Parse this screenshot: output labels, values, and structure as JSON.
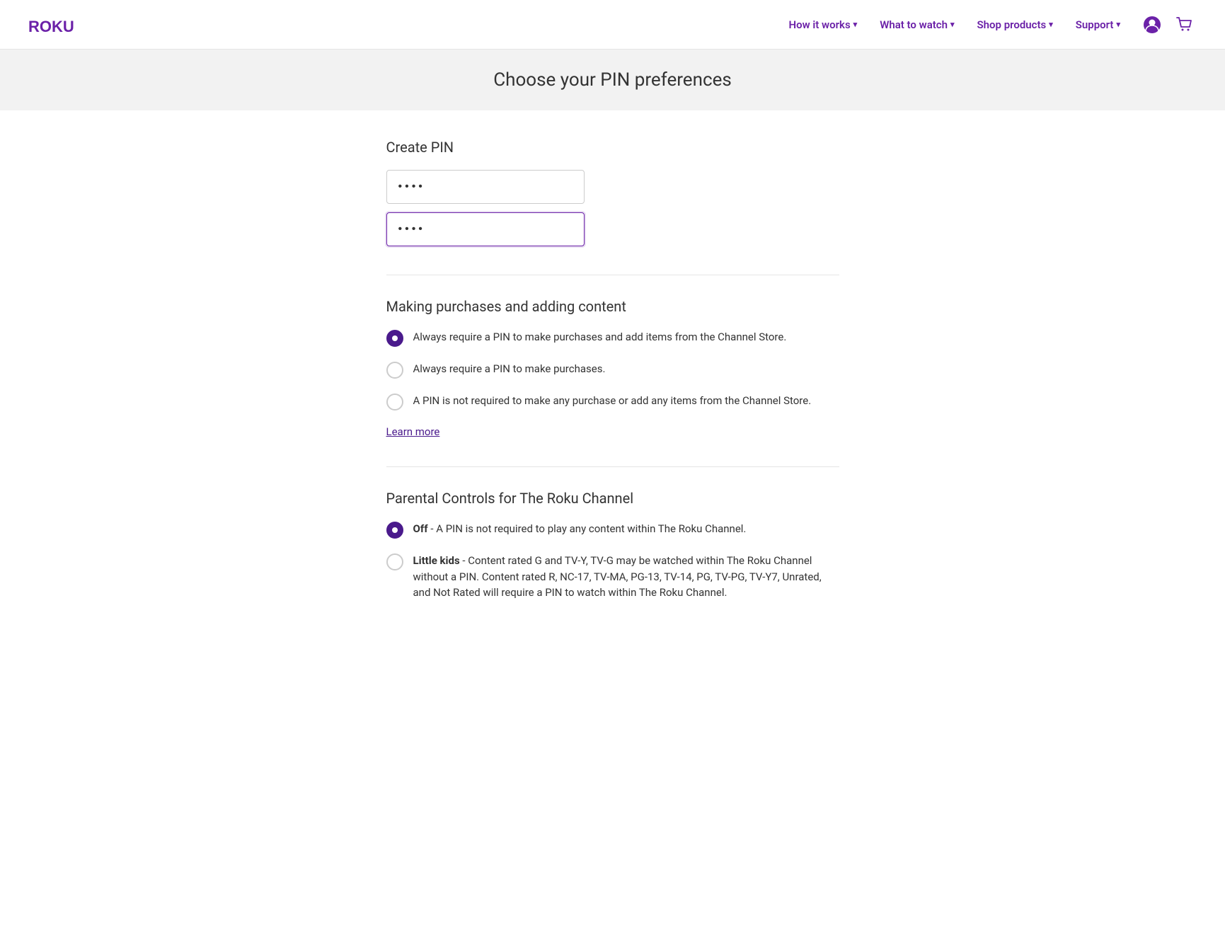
{
  "nav": {
    "logo_text": "Roku",
    "links": [
      {
        "id": "how-it-works",
        "label": "How it works",
        "has_dropdown": true
      },
      {
        "id": "what-to-watch",
        "label": "What to watch",
        "has_dropdown": true
      },
      {
        "id": "shop-products",
        "label": "Shop products",
        "has_dropdown": true
      },
      {
        "id": "support",
        "label": "Support",
        "has_dropdown": true
      }
    ]
  },
  "page": {
    "header_title": "Choose your PIN preferences"
  },
  "create_pin": {
    "section_title": "Create PIN",
    "pin_placeholder": "••••",
    "pin_value": "••••",
    "confirm_pin_value": "••••"
  },
  "purchases_section": {
    "section_title": "Making purchases and adding content",
    "options": [
      {
        "id": "option-always-purchases-channel",
        "label": "Always require a PIN to make purchases and add items from the Channel Store.",
        "selected": true
      },
      {
        "id": "option-always-purchases",
        "label": "Always require a PIN to make purchases.",
        "selected": false
      },
      {
        "id": "option-no-pin",
        "label": "A PIN is not required to make any purchase or add any items from the Channel Store.",
        "selected": false
      }
    ],
    "learn_more_label": "Learn more"
  },
  "parental_controls": {
    "section_title": "Parental Controls for The Roku Channel",
    "options": [
      {
        "id": "parental-off",
        "label_bold": "Off",
        "label": " - A PIN is not required to play any content within The Roku Channel.",
        "selected": true
      },
      {
        "id": "parental-little-kids",
        "label_bold": "Little kids",
        "label": " - Content rated G and TV-Y, TV-G may be watched within The Roku Channel without a PIN. Content rated R, NC-17, TV-MA, PG-13, TV-14, PG, TV-PG, TV-Y7, Unrated, and Not Rated will require a PIN to watch within The Roku Channel.",
        "selected": false
      }
    ]
  }
}
